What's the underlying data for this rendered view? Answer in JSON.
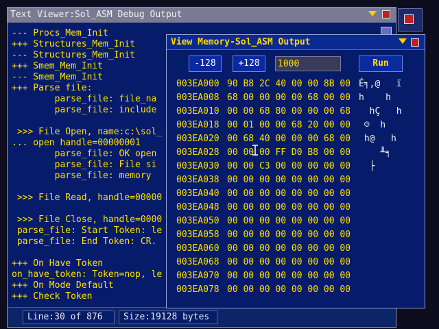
{
  "text_viewer": {
    "title": "Text Viewer:Sol_ASM Debug Output",
    "lines": [
      "--- Procs_Mem_Init",
      "+++ Structures_Mem_Init",
      "--- Structures_Mem_Init",
      "+++ Smem_Mem_Init",
      "--- Smem_Mem_Init",
      "+++ Parse file:",
      "        parse_file: file_na",
      "        parse_file: include",
      "",
      " >>> File Open, name:c:\\sol_",
      "... open handle=00000001",
      "        parse_file: OK open",
      "        parse_file: File si",
      "        parse_file: memory ",
      "",
      " >>> File Read, handle=00000",
      "",
      " >>> File Close, handle=0000",
      " parse_file: Start Token: le",
      " parse_file: End Token: CR.",
      "",
      "+++ On Have Token",
      "on_have_token: Token=nop, le",
      "+++ On Mode Default",
      "+++ Check Token"
    ],
    "status": {
      "line": "Line:30 of 876",
      "size": "Size:19128 bytes"
    }
  },
  "memory_view": {
    "title": "View Memory-Sol_ASM Output",
    "btn_prev": "-128",
    "btn_next": "+128",
    "address_value": "1000",
    "btn_run": "Run",
    "rows": [
      {
        "addr": "003EA000",
        "hex": "90 B8 2C 40 00 00 8B 00",
        "ascii": "É╕,@   ï"
      },
      {
        "addr": "003EA008",
        "hex": "68 00 00 00 00 68 00 00",
        "ascii": "h    h"
      },
      {
        "addr": "003EA010",
        "hex": "00 00 68 80 00 00 00 68",
        "ascii": "  hÇ   h"
      },
      {
        "addr": "003EA018",
        "hex": "00 01 00 00 68 20 00 00",
        "ascii": " ☺  h"
      },
      {
        "addr": "003EA020",
        "hex": "00 68 40 00 00 00 68 00",
        "ascii": " h@   h"
      },
      {
        "addr": "003EA028",
        "hex": "00 00 00 FF D0 B8 00 00",
        "ascii": "    ╨╕"
      },
      {
        "addr": "003EA030",
        "hex": "00 00 C3 00 00 00 00 00",
        "ascii": "  ├"
      },
      {
        "addr": "003EA038",
        "hex": "00 00 00 00 00 00 00 00",
        "ascii": ""
      },
      {
        "addr": "003EA040",
        "hex": "00 00 00 00 00 00 00 00",
        "ascii": ""
      },
      {
        "addr": "003EA048",
        "hex": "00 00 00 00 00 00 00 00",
        "ascii": ""
      },
      {
        "addr": "003EA050",
        "hex": "00 00 00 00 00 00 00 00",
        "ascii": ""
      },
      {
        "addr": "003EA058",
        "hex": "00 00 00 00 00 00 00 00",
        "ascii": ""
      },
      {
        "addr": "003EA060",
        "hex": "00 00 00 00 00 00 00 00",
        "ascii": ""
      },
      {
        "addr": "003EA068",
        "hex": "00 00 00 00 00 00 00 00",
        "ascii": ""
      },
      {
        "addr": "003EA070",
        "hex": "00 00 00 00 00 00 00 00",
        "ascii": ""
      },
      {
        "addr": "003EA078",
        "hex": "00 00 00 00 00 00 00 00",
        "ascii": ""
      }
    ]
  },
  "colors": {
    "desktop": "#0d0d1e",
    "window_body": "#061c6a",
    "text_yellow": "#ffe000",
    "close_red": "#c02020",
    "title_gray": "#7a7a92"
  },
  "icons": [
    "menu-arrow-icon",
    "close-icon",
    "mouse-cursor-icon"
  ]
}
